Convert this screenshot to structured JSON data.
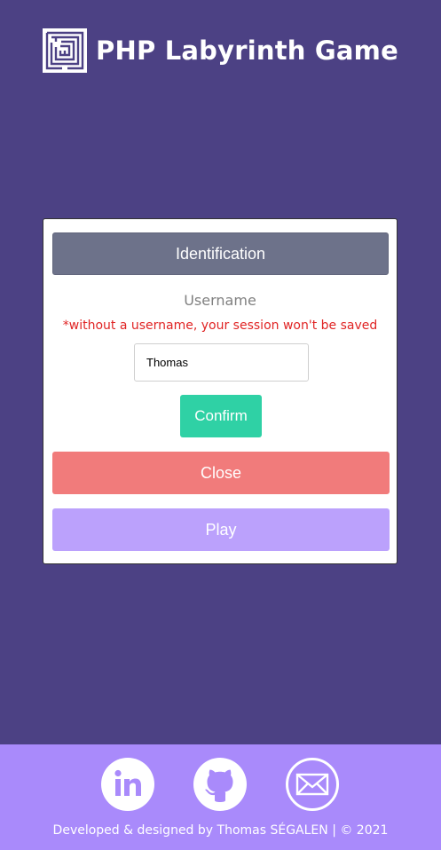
{
  "header": {
    "title": "PHP Labyrinth Game",
    "logo_icon": "maze-icon"
  },
  "card": {
    "heading": "Identification",
    "username_label": "Username",
    "warning": "*without a username, your session won't be saved",
    "username_value": "Thomas",
    "confirm_label": "Confirm",
    "close_label": "Close",
    "play_label": "Play"
  },
  "footer": {
    "links": [
      {
        "icon": "linkedin-icon"
      },
      {
        "icon": "github-icon"
      },
      {
        "icon": "mail-icon"
      }
    ],
    "copyright": "Developed & designed by Thomas SÉGALEN | © 2021"
  },
  "colors": {
    "background": "#4c4184",
    "identification": "#6d728a",
    "warning": "#e02424",
    "confirm": "#2fd1a5",
    "close": "#f17b7b",
    "play": "#bba1fc",
    "footer": "#a98afb"
  }
}
